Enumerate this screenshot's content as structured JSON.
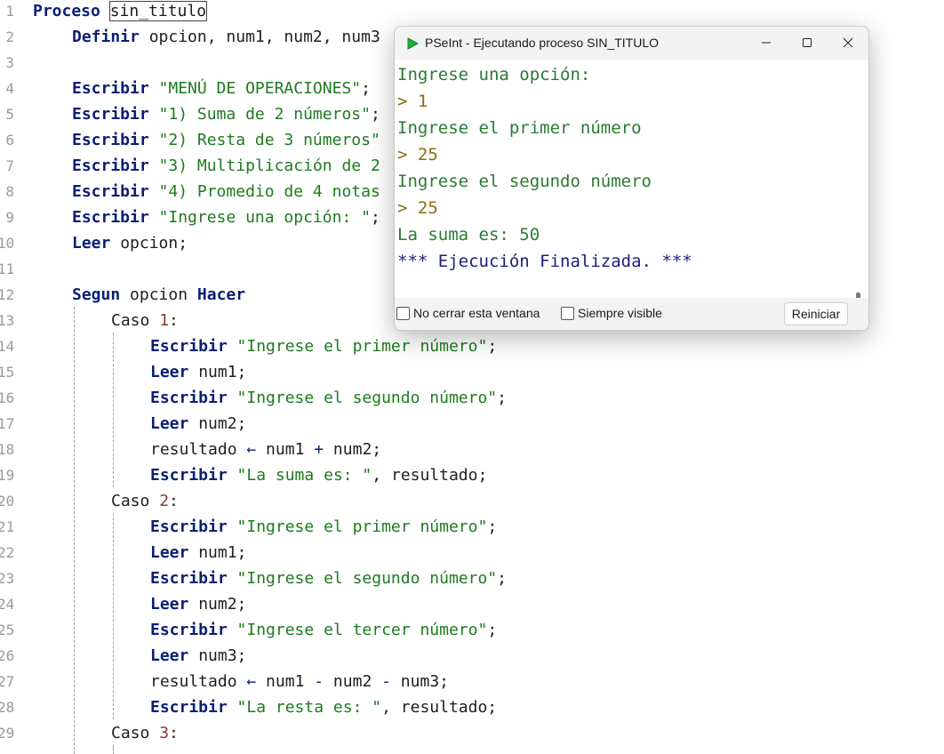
{
  "editor": {
    "process_keyword": "Proceso",
    "process_name": "sin_titulo",
    "lines": [
      {
        "n": "1",
        "kw": "",
        "text": ""
      },
      {
        "n": "2"
      },
      {
        "n": "3"
      },
      {
        "n": "4"
      },
      {
        "n": "5"
      },
      {
        "n": "6"
      },
      {
        "n": "7"
      },
      {
        "n": "8"
      },
      {
        "n": "9"
      },
      {
        "n": "10"
      },
      {
        "n": "11"
      },
      {
        "n": "12"
      },
      {
        "n": "13"
      },
      {
        "n": "14"
      },
      {
        "n": "15"
      },
      {
        "n": "16"
      },
      {
        "n": "17"
      },
      {
        "n": "18"
      },
      {
        "n": "19"
      },
      {
        "n": "20"
      },
      {
        "n": "21"
      },
      {
        "n": "22"
      },
      {
        "n": "23"
      },
      {
        "n": "24"
      },
      {
        "n": "25"
      },
      {
        "n": "26"
      },
      {
        "n": "27"
      },
      {
        "n": "28"
      },
      {
        "n": "29"
      }
    ],
    "l2": {
      "kw": "Definir",
      "rest": " opcion, num1, num2, num3"
    },
    "l4": {
      "kw": "Escribir",
      "str": " \"MENÚ DE OPERACIONES\"",
      "end": ";"
    },
    "l5": {
      "kw": "Escribir",
      "str": " \"1) Suma de 2 números\"",
      "end": ";"
    },
    "l6": {
      "kw": "Escribir",
      "str": " \"2) Resta de 3 números\"",
      "end": ""
    },
    "l7": {
      "kw": "Escribir",
      "str": " \"3) Multiplicación de 2",
      "end": ""
    },
    "l8": {
      "kw": "Escribir",
      "str": " \"4) Promedio de 4 notas",
      "end": ""
    },
    "l9": {
      "kw": "Escribir",
      "str": " \"Ingrese una opción: \"",
      "end": ";"
    },
    "l10": {
      "kw": "Leer",
      "rest": " opcion;"
    },
    "l12": {
      "kw": "Segun",
      "mid": " opcion ",
      "kw2": "Hacer"
    },
    "l13": {
      "label": "Caso ",
      "num": "1",
      "end": ":"
    },
    "l14": {
      "kw": "Escribir",
      "str": " \"Ingrese el primer número\"",
      "end": ";"
    },
    "l15": {
      "kw": "Leer",
      "rest": " num1;"
    },
    "l16": {
      "kw": "Escribir",
      "str": " \"Ingrese el segundo número\"",
      "end": ";"
    },
    "l17": {
      "kw": "Leer",
      "rest": " num2;"
    },
    "l18": {
      "a": "resultado ",
      "arrow": "←",
      "b": " num1 ",
      "op": "+",
      "c": " num2;"
    },
    "l19": {
      "kw": "Escribir",
      "str": " \"La suma es: \"",
      "end": ", resultado;"
    },
    "l20": {
      "label": "Caso ",
      "num": "2",
      "end": ":"
    },
    "l21": {
      "kw": "Escribir",
      "str": " \"Ingrese el primer número\"",
      "end": ";"
    },
    "l22": {
      "kw": "Leer",
      "rest": " num1;"
    },
    "l23": {
      "kw": "Escribir",
      "str": " \"Ingrese el segundo número\"",
      "end": ";"
    },
    "l24": {
      "kw": "Leer",
      "rest": " num2;"
    },
    "l25": {
      "kw": "Escribir",
      "str": " \"Ingrese el tercer número\"",
      "end": ";"
    },
    "l26": {
      "kw": "Leer",
      "rest": " num3;"
    },
    "l27": {
      "a": "resultado ",
      "arrow": "←",
      "b": " num1 ",
      "op": "-",
      "c": " num2 ",
      "op2": "-",
      "d": " num3;"
    },
    "l28": {
      "kw": "Escribir",
      "str": " \"La resta es: \"",
      "end": ", resultado;"
    },
    "l29": {
      "label": "Caso ",
      "num": "3",
      "end": ":"
    }
  },
  "run_window": {
    "title": "PSeInt - Ejecutando proceso SIN_TITULO",
    "console": [
      {
        "text": "Ingrese una opción:",
        "kind": "prompt"
      },
      {
        "text": "> 1",
        "kind": "input"
      },
      {
        "text": "Ingrese el primer número",
        "kind": "prompt"
      },
      {
        "text": "> 25",
        "kind": "input"
      },
      {
        "text": "Ingrese el segundo número",
        "kind": "prompt"
      },
      {
        "text": "> 25",
        "kind": "input"
      },
      {
        "text": "La suma es: 50",
        "kind": "prompt"
      },
      {
        "text": "*** Ejecución Finalizada. ***",
        "kind": "end"
      }
    ],
    "no_cerrar_label": "No cerrar esta ventana",
    "siempre_visible_label": "Siempre visible",
    "reiniciar_label": "Reiniciar",
    "icons": {
      "app": "play-icon",
      "minimize": "minimize-icon",
      "maximize": "maximize-icon",
      "close": "close-icon"
    },
    "colors": {
      "prompt": "#2a7a33",
      "input": "#8a6e0e",
      "end": "#1a1f7a",
      "app_icon": "#1fae3a"
    }
  }
}
